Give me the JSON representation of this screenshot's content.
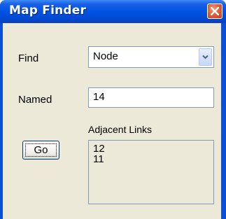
{
  "window": {
    "title": "Map Finder"
  },
  "find": {
    "label": "Find",
    "selected": "Node"
  },
  "named": {
    "label": "Named",
    "value": "14"
  },
  "adjacent_links": {
    "label": "Adjacent Links",
    "items": [
      "12",
      "11"
    ]
  },
  "go_button": {
    "label": "Go"
  },
  "colors": {
    "titlebar": "#0055e5",
    "close_button": "#e0603a",
    "dialog_background": "#ece9d8",
    "input_border": "#7f9db9"
  },
  "icons": {
    "close": "close-icon",
    "dropdown": "chevron-down-icon"
  }
}
